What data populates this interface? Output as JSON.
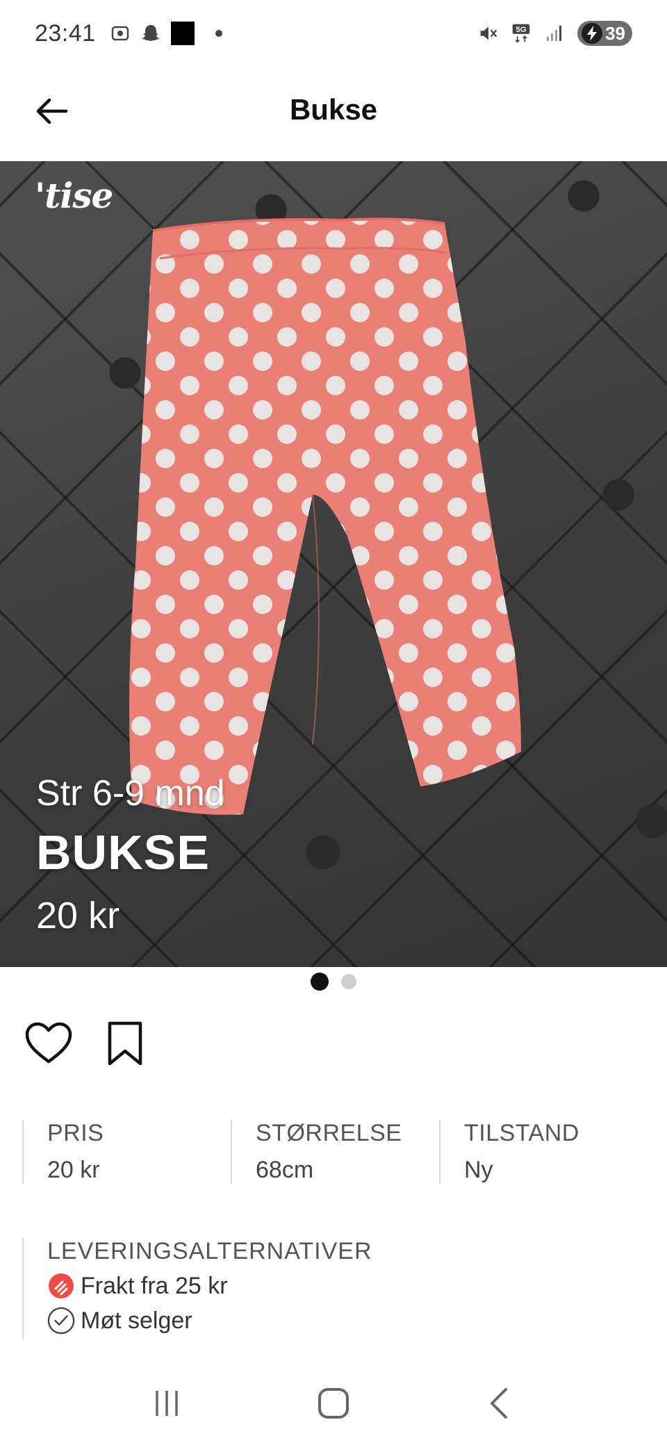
{
  "status_bar": {
    "time": "23:41",
    "network": "5G",
    "battery": "39",
    "icons": [
      "screenshot-icon",
      "snapchat-icon",
      "app-icon",
      "mute-icon",
      "signal-icon",
      "battery-charging-icon"
    ]
  },
  "header": {
    "title": "Bukse",
    "back_icon": "arrow-left-icon"
  },
  "listing_image": {
    "logo": "'tise",
    "size_text": "Str 6-9 mnd",
    "title_text": "BUKSE",
    "price_text": "20 kr",
    "page_count": 2,
    "current_page": 1
  },
  "actions": {
    "like_icon": "heart-icon",
    "save_icon": "bookmark-icon"
  },
  "details": [
    {
      "label": "PRIS",
      "value": "20 kr"
    },
    {
      "label": "STØRRELSE",
      "value": "68cm"
    },
    {
      "label": "TILSTAND",
      "value": "Ny"
    }
  ],
  "delivery": {
    "label": "LEVERINGSALTERNATIVER",
    "options": [
      {
        "text": "Frakt fra 25 kr",
        "icon": "shipping-icon"
      },
      {
        "text": "Møt selger",
        "icon": "check-circle-icon"
      }
    ]
  },
  "nav_bar": {
    "icons": [
      "recents-icon",
      "home-icon",
      "back-icon"
    ]
  },
  "colors": {
    "pants": "#f4867a",
    "dots": "#f3eeee",
    "shipping_badge": "#ef4b45",
    "background_fabric": "#444444"
  }
}
